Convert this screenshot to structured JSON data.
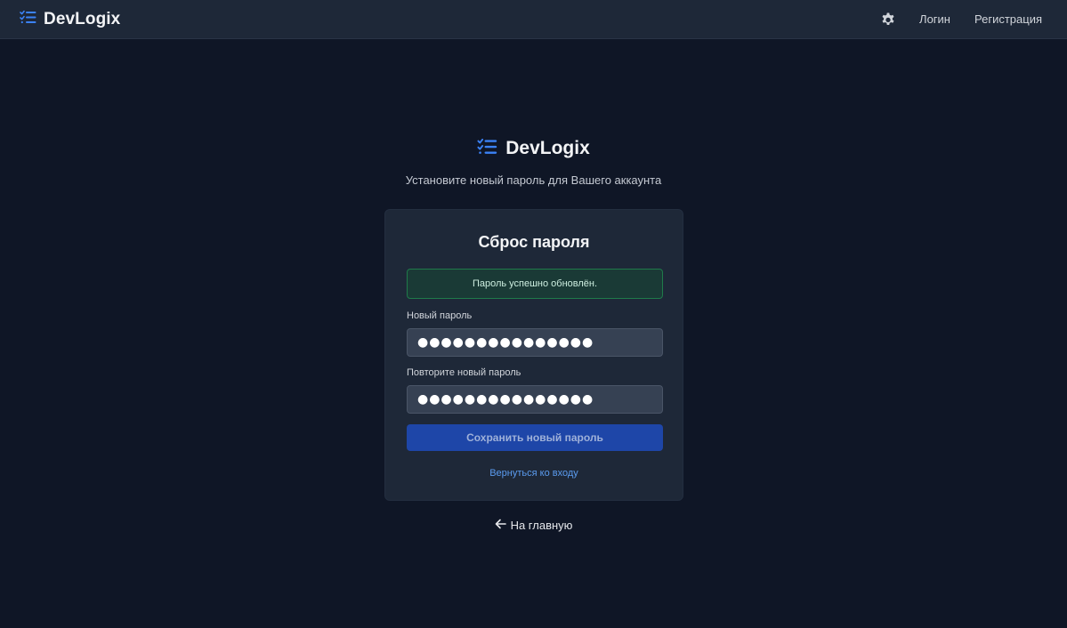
{
  "header": {
    "brand": "DevLogix",
    "settings_icon": "gear-icon",
    "nav": {
      "login": "Логин",
      "register": "Регистрация"
    }
  },
  "hero": {
    "brand": "DevLogix",
    "subtitle": "Установите новый пароль для Вашего аккаунта"
  },
  "card": {
    "title": "Сброс пароля",
    "alert": "Пароль успешно обновлён.",
    "new_password_label": "Новый пароль",
    "new_password_value": "●●●●●●●●●●●●●●●",
    "repeat_password_label": "Повторите новый пароль",
    "repeat_password_value": "●●●●●●●●●●●●●●●",
    "submit_label": "Сохранить новый пароль",
    "back_to_login": "Вернуться ко входу"
  },
  "home_link": "На главную",
  "colors": {
    "accent": "#3b82f6",
    "background": "#0f1626",
    "card": "#1e2838",
    "success": "#1f7a4a"
  }
}
